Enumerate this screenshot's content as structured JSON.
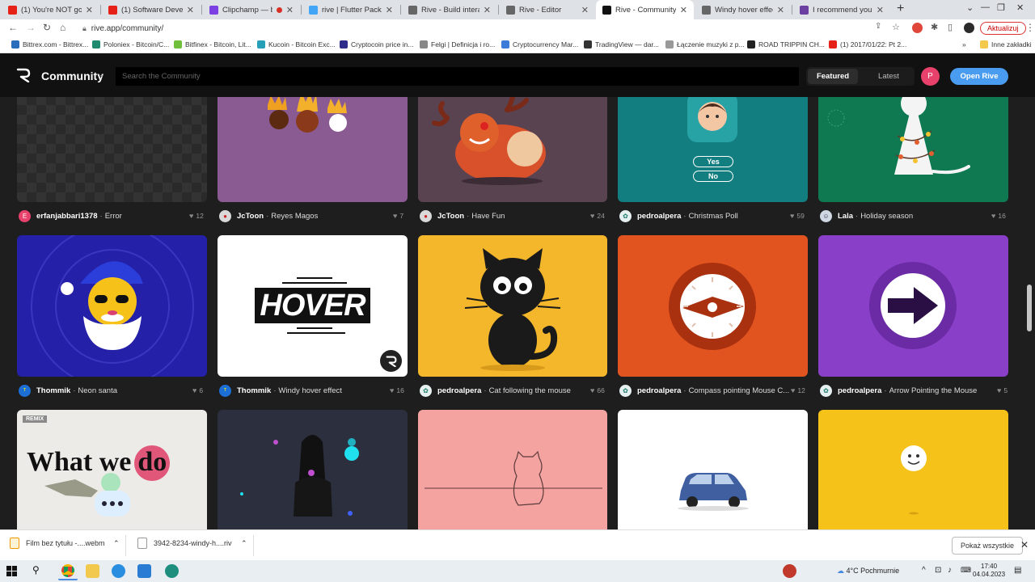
{
  "browser": {
    "tabs": [
      {
        "label": "(1) You're NOT going",
        "icon_color": "#e62117"
      },
      {
        "label": "(1) Software Develope",
        "icon_color": "#e62117"
      },
      {
        "label": "Clipchamp — bez",
        "icon_color": "#7b3fe4"
      },
      {
        "label": "rive | Flutter Package",
        "icon_color": "#42a5f5"
      },
      {
        "label": "Rive - Build interactiv",
        "icon_color": "#666666"
      },
      {
        "label": "Rive - Editor",
        "icon_color": "#666666"
      },
      {
        "label": "Rive - Community",
        "icon_color": "#111111",
        "active": true
      },
      {
        "label": "Windy hover effect by",
        "icon_color": "#666666"
      },
      {
        "label": "I recommend you to",
        "icon_color": "#6b3fa0"
      }
    ],
    "url": "rive.app/community/",
    "update_label": "Aktualizuj",
    "bookmarks": [
      {
        "label": "Bittrex.com - Bittrex...",
        "icon_color": "#2a6ebb"
      },
      {
        "label": "Poloniex - Bitcoin/C...",
        "icon_color": "#1f8a70"
      },
      {
        "label": "Bitfinex - Bitcoin, Lit...",
        "icon_color": "#6fbf3a"
      },
      {
        "label": "Kucoin - Bitcoin Exc...",
        "icon_color": "#25a0b8"
      },
      {
        "label": "Cryptocoin price in...",
        "icon_color": "#2e2e8a"
      },
      {
        "label": "Felgi | Definicja i ro...",
        "icon_color": "#888888"
      },
      {
        "label": "Cryptocurrency Mar...",
        "icon_color": "#3d7bd9"
      },
      {
        "label": "TradingView — dar...",
        "icon_color": "#333333"
      },
      {
        "label": "Łączenie muzyki z p...",
        "icon_color": "#999999"
      },
      {
        "label": "ROAD TRIPPIN CH...",
        "icon_color": "#222222"
      },
      {
        "label": "(1) 2017/01/22: Pt 2...",
        "icon_color": "#e62117"
      }
    ],
    "other_bookmarks": "Inne zakładki"
  },
  "site": {
    "brand": "Community",
    "search_placeholder": "Search the Community",
    "featured_label": "Featured",
    "latest_label": "Latest",
    "avatar_letter": "P",
    "open_rive_label": "Open Rive"
  },
  "cards": [
    {
      "author": "erfanjabbari1378",
      "title": "Error",
      "likes": "12",
      "bg": "#2a2a2a",
      "avatar_color": "#e8416b",
      "avatar_letter": "E"
    },
    {
      "author": "JcToon",
      "title": "Reyes Magos",
      "likes": "7",
      "bg": "#8a5a92",
      "avatar_color": "#d9d9d9",
      "avatar_letter": ""
    },
    {
      "author": "JcToon",
      "title": "Have Fun",
      "likes": "24",
      "bg": "#5a4350",
      "avatar_color": "#d9d9d9",
      "avatar_letter": ""
    },
    {
      "author": "pedroalpera",
      "title": "Christmas Poll",
      "likes": "59",
      "bg": "#137e80",
      "avatar_color": "#e6f0f0",
      "avatar_letter": ""
    },
    {
      "author": "Lala",
      "title": "Holiday season",
      "likes": "16",
      "bg": "#0f7a52",
      "avatar_color": "#cfd8e3",
      "avatar_letter": ""
    },
    {
      "author": "Thommik",
      "title": "Neon santa",
      "likes": "6",
      "bg": "#2420a8",
      "avatar_color": "#1d6fd6",
      "avatar_letter": ""
    },
    {
      "author": "Thommik",
      "title": "Windy hover effect",
      "likes": "16",
      "bg": "#ffffff",
      "avatar_color": "#1d6fd6",
      "avatar_letter": ""
    },
    {
      "author": "pedroalpera",
      "title": "Cat following the mouse",
      "likes": "66",
      "bg": "#f4b62a",
      "avatar_color": "#e6f0f0",
      "avatar_letter": ""
    },
    {
      "author": "pedroalpera",
      "title": "Compass pointing Mouse C...",
      "likes": "12",
      "bg": "#e2541f",
      "avatar_color": "#e6f0f0",
      "avatar_letter": ""
    },
    {
      "author": "pedroalpera",
      "title": "Arrow Pointing the Mouse",
      "likes": "5",
      "bg": "#8a3fc9",
      "avatar_color": "#e6f0f0",
      "avatar_letter": ""
    },
    {
      "author": "",
      "title": "",
      "likes": "",
      "bg": "#ecebe8"
    },
    {
      "author": "",
      "title": "",
      "likes": "",
      "bg": "#2b2f3e"
    },
    {
      "author": "",
      "title": "",
      "likes": "",
      "bg": "#f4a3a0"
    },
    {
      "author": "",
      "title": "",
      "likes": "",
      "bg": "#ffffff"
    },
    {
      "author": "",
      "title": "",
      "likes": "",
      "bg": "#f5c219"
    }
  ],
  "card_text": {
    "poll_yes": "Yes",
    "poll_no": "No",
    "hover_word": "HOVER",
    "remix_badge": "REMIX",
    "what_we_do_a": "What we",
    "what_we_do_b": "do"
  },
  "downloads": [
    {
      "name": "Film bez tytułu -....webm"
    },
    {
      "name": "3942-8234-windy-h....riv"
    }
  ],
  "show_all_label": "Pokaż wszystkie",
  "taskbar": {
    "weather": "4°C  Pochmurnie",
    "time": "17:40",
    "date": "04.04.2023"
  }
}
